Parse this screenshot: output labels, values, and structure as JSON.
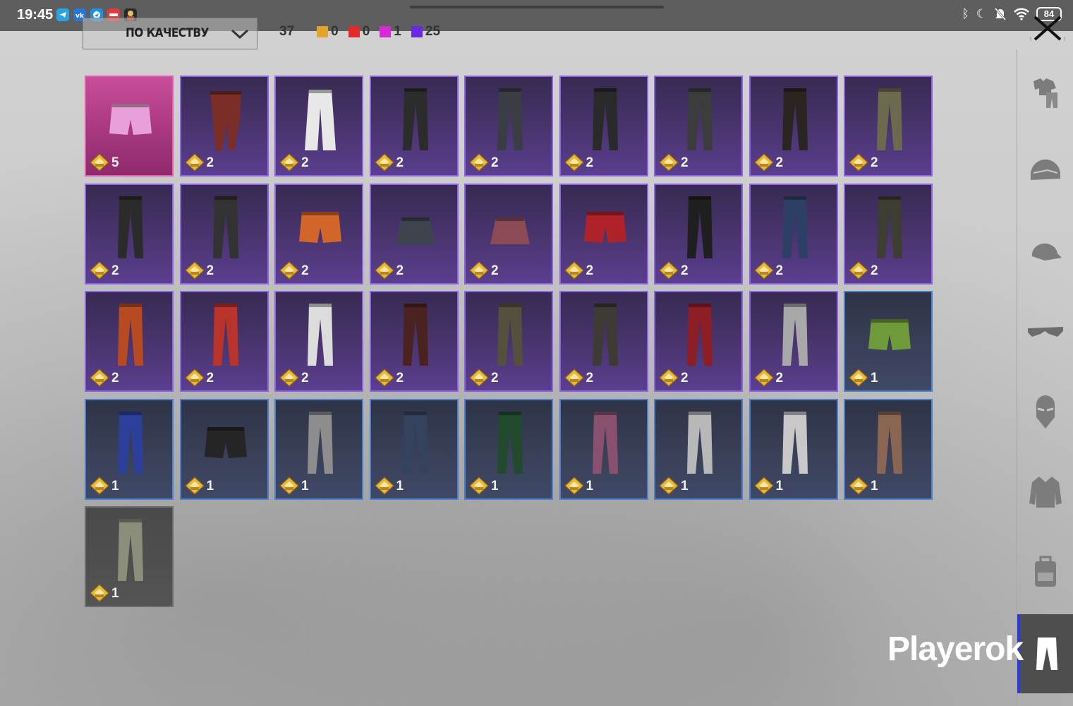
{
  "status_bar": {
    "time": "19:45",
    "battery": "84",
    "apps": [
      "telegram-app",
      "vk-app",
      "messenger-app",
      "red-app",
      "character-app"
    ],
    "right_icons": [
      "bluetooth-icon",
      "moon-icon",
      "muted-bell-icon",
      "wifi-icon"
    ]
  },
  "toolbar": {
    "sort_label": "ПО КАЧЕСТВУ",
    "total": "37",
    "counts": [
      {
        "color": "#e3a42a",
        "value": "0"
      },
      {
        "color": "#e32a2a",
        "value": "0"
      },
      {
        "color": "#d62ad6",
        "value": "1"
      },
      {
        "color": "#6a2ae3",
        "value": "25"
      }
    ]
  },
  "rarity_colors": {
    "mythic": "#e060b0",
    "epic": "#8d63e8",
    "rare": "#4d7fd0",
    "common": "#6d6d6d"
  },
  "items": [
    {
      "rarity": "mythic",
      "kind": "shorts",
      "color": "#e8a0d8",
      "qty": "5"
    },
    {
      "rarity": "epic",
      "kind": "skirt-pants",
      "color": "#7a2e26",
      "qty": "2"
    },
    {
      "rarity": "epic",
      "kind": "wide-pants",
      "color": "#e8e8e8",
      "qty": "2"
    },
    {
      "rarity": "epic",
      "kind": "pants",
      "color": "#2c2c2c",
      "qty": "2"
    },
    {
      "rarity": "epic",
      "kind": "pants",
      "color": "#3a3d44",
      "qty": "2"
    },
    {
      "rarity": "epic",
      "kind": "pants",
      "color": "#2a2a2a",
      "qty": "2"
    },
    {
      "rarity": "epic",
      "kind": "pants",
      "color": "#3c3c3c",
      "qty": "2"
    },
    {
      "rarity": "epic",
      "kind": "pants",
      "color": "#2a2520",
      "qty": "2"
    },
    {
      "rarity": "epic",
      "kind": "pants",
      "color": "#6b6a4e",
      "qty": "2"
    },
    {
      "rarity": "epic",
      "kind": "pants",
      "color": "#2b2b2b",
      "qty": "2"
    },
    {
      "rarity": "epic",
      "kind": "pants",
      "color": "#323232",
      "qty": "2"
    },
    {
      "rarity": "epic",
      "kind": "shorts",
      "color": "#d2652a",
      "qty": "2"
    },
    {
      "rarity": "epic",
      "kind": "skirt",
      "color": "#3e444e",
      "qty": "2"
    },
    {
      "rarity": "epic",
      "kind": "skirt",
      "color": "#8a4a56",
      "qty": "2"
    },
    {
      "rarity": "epic",
      "kind": "shorts",
      "color": "#b0222a",
      "qty": "2"
    },
    {
      "rarity": "epic",
      "kind": "pants",
      "color": "#1f1f1f",
      "qty": "2"
    },
    {
      "rarity": "epic",
      "kind": "pants",
      "color": "#2e3f66",
      "qty": "2"
    },
    {
      "rarity": "epic",
      "kind": "pants",
      "color": "#3d3d32",
      "qty": "2"
    },
    {
      "rarity": "epic",
      "kind": "pants",
      "color": "#b84a22",
      "qty": "2"
    },
    {
      "rarity": "epic",
      "kind": "pants",
      "color": "#b8332a",
      "qty": "2"
    },
    {
      "rarity": "epic",
      "kind": "pants",
      "color": "#dcdcdc",
      "qty": "2"
    },
    {
      "rarity": "epic",
      "kind": "pants",
      "color": "#4a2220",
      "qty": "2"
    },
    {
      "rarity": "epic",
      "kind": "pants",
      "color": "#55503e",
      "qty": "2"
    },
    {
      "rarity": "epic",
      "kind": "pants",
      "color": "#3e3a34",
      "qty": "2"
    },
    {
      "rarity": "epic",
      "kind": "pants",
      "color": "#8e1e26",
      "qty": "2"
    },
    {
      "rarity": "epic",
      "kind": "pants",
      "color": "#a8a8a8",
      "qty": "2"
    },
    {
      "rarity": "rare",
      "kind": "shorts",
      "color": "#6e9a3a",
      "qty": "1"
    },
    {
      "rarity": "rare",
      "kind": "pants",
      "color": "#2c3f9a",
      "qty": "1"
    },
    {
      "rarity": "rare",
      "kind": "shorts",
      "color": "#252525",
      "qty": "1"
    },
    {
      "rarity": "rare",
      "kind": "pants",
      "color": "#8d8d8d",
      "qty": "1"
    },
    {
      "rarity": "rare",
      "kind": "pants",
      "color": "#34425e",
      "qty": "1"
    },
    {
      "rarity": "rare",
      "kind": "pants",
      "color": "#224a2c",
      "qty": "1"
    },
    {
      "rarity": "rare",
      "kind": "pants",
      "color": "#8a5070",
      "qty": "1"
    },
    {
      "rarity": "rare",
      "kind": "pants",
      "color": "#b8b8b8",
      "qty": "1"
    },
    {
      "rarity": "rare",
      "kind": "pants",
      "color": "#c8c8c8",
      "qty": "1"
    },
    {
      "rarity": "rare",
      "kind": "pants",
      "color": "#8a6652",
      "qty": "1"
    },
    {
      "rarity": "common",
      "kind": "pants",
      "color": "#8a8e7a",
      "qty": "1"
    }
  ],
  "sidebar": {
    "categories": [
      {
        "name": "outfit-icon"
      },
      {
        "name": "helmet-icon"
      },
      {
        "name": "cap-icon"
      },
      {
        "name": "glasses-icon"
      },
      {
        "name": "mask-icon"
      },
      {
        "name": "jacket-icon"
      },
      {
        "name": "backpack-icon"
      },
      {
        "name": "pants-icon",
        "active": true
      }
    ]
  },
  "watermark": "Playerok"
}
